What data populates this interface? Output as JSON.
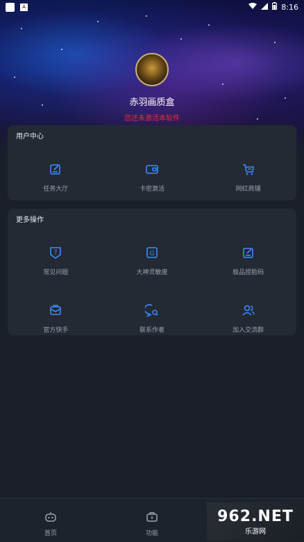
{
  "status_bar": {
    "time": "8:16",
    "a_badge": "A"
  },
  "profile": {
    "app_name": "赤羽画质盒",
    "notice": "您还未激活本软件"
  },
  "user_center": {
    "title": "用户中心",
    "items": [
      {
        "label": "任务大厅",
        "icon": "edit-square-icon"
      },
      {
        "label": "卡密激活",
        "icon": "wallet-icon"
      },
      {
        "label": "网红商铺",
        "icon": "cart-icon"
      }
    ]
  },
  "more_actions": {
    "title": "更多操作",
    "items": [
      {
        "label": "常见问题",
        "icon": "question-shield-icon"
      },
      {
        "label": "大神灵敏度",
        "icon": "g-square-icon"
      },
      {
        "label": "极品捏脸码",
        "icon": "edit-square-icon"
      },
      {
        "label": "官方快手",
        "icon": "mail-icon"
      },
      {
        "label": "联系作者",
        "icon": "chat-search-icon"
      },
      {
        "label": "加入交流群",
        "icon": "users-icon"
      }
    ]
  },
  "bottom_nav": [
    {
      "label": "首页",
      "icon": "robot-icon"
    },
    {
      "label": "功能",
      "icon": "toolbox-icon"
    }
  ],
  "watermark": {
    "brand_num": "962",
    "brand_tld": ".NET",
    "brand_text": "乐游网"
  },
  "colors": {
    "accent": "#3d8cff",
    "notice": "#e0303a",
    "card": "#232a34",
    "background": "#1a1f27"
  }
}
